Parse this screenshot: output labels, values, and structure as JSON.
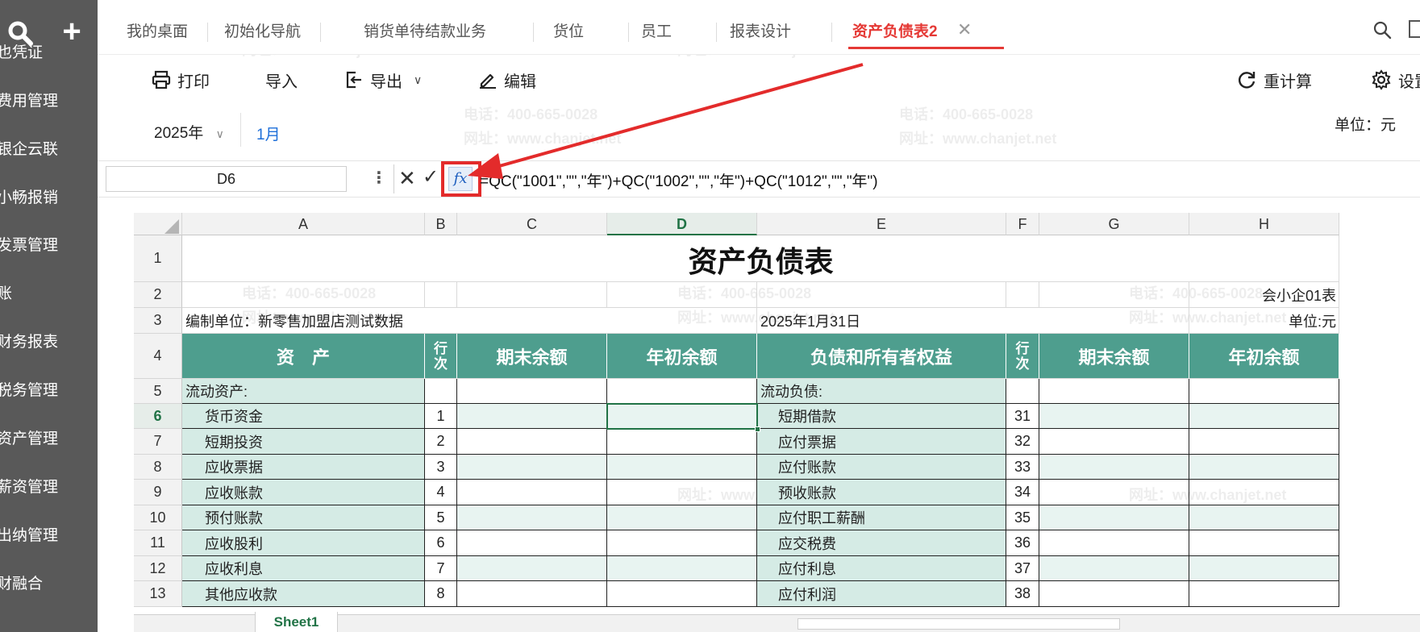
{
  "sidebar": {
    "items": [
      "也凭证",
      "费用管理",
      "银企云联",
      "小畅报销",
      "发票管理",
      "账",
      "财务报表",
      "税务管理",
      "资产管理",
      "薪资管理",
      "出纳管理",
      "财融合"
    ]
  },
  "tabs": [
    {
      "label": "我的桌面"
    },
    {
      "label": "初始化导航"
    },
    {
      "label": "销货单待结款业务"
    },
    {
      "label": "货位"
    },
    {
      "label": "员工"
    },
    {
      "label": "报表设计"
    },
    {
      "label": "资产负债表2",
      "active": true
    }
  ],
  "toolbar": {
    "print": "打印",
    "import": "导入",
    "export": "导出",
    "edit": "编辑",
    "recalc": "重计算",
    "settings": "设置"
  },
  "period": {
    "year": "2025年",
    "month": "1月",
    "unit": "单位：元"
  },
  "formula_bar": {
    "cell_ref": "D6",
    "formula": "=QC(\"1001\",\"\",\"年\")+QC(\"1002\",\"\",\"年\")+QC(\"1012\",\"\",\"年\")"
  },
  "sheet": {
    "columns": [
      "A",
      "B",
      "C",
      "D",
      "E",
      "F",
      "G",
      "H"
    ],
    "row_numbers": [
      "1",
      "2",
      "3",
      "4",
      "5",
      "6",
      "7",
      "8",
      "9",
      "10",
      "11",
      "12",
      "13"
    ],
    "title": "资产负债表",
    "form_code": "会小企01表",
    "company": "编制单位：新零售加盟店测试数据",
    "date": "2025年1月31日",
    "unit": "单位:元",
    "headers": {
      "assets": "资　产",
      "line_no": "行次",
      "end_balance": "期末余额",
      "begin_balance": "年初余额",
      "liabilities": "负债和所有者权益"
    },
    "section_left": "流动资产:",
    "section_right": "流动负债:",
    "rows": [
      {
        "asset": "货币资金",
        "a_no": "1",
        "liab": "短期借款",
        "l_no": "31"
      },
      {
        "asset": "短期投资",
        "a_no": "2",
        "liab": "应付票据",
        "l_no": "32"
      },
      {
        "asset": "应收票据",
        "a_no": "3",
        "liab": "应付账款",
        "l_no": "33"
      },
      {
        "asset": "应收账款",
        "a_no": "4",
        "liab": "预收账款",
        "l_no": "34"
      },
      {
        "asset": "预付账款",
        "a_no": "5",
        "liab": "应付职工薪酬",
        "l_no": "35"
      },
      {
        "asset": "应收股利",
        "a_no": "6",
        "liab": "应交税费",
        "l_no": "36"
      },
      {
        "asset": "应收利息",
        "a_no": "7",
        "liab": "应付利息",
        "l_no": "37"
      },
      {
        "asset": "其他应收款",
        "a_no": "8",
        "liab": "应付利润",
        "l_no": "38"
      }
    ],
    "sheet_tab": "Sheet1"
  },
  "watermark": {
    "phone": "电话：400-665-0028",
    "site": "网址：www.chanjet.net"
  }
}
